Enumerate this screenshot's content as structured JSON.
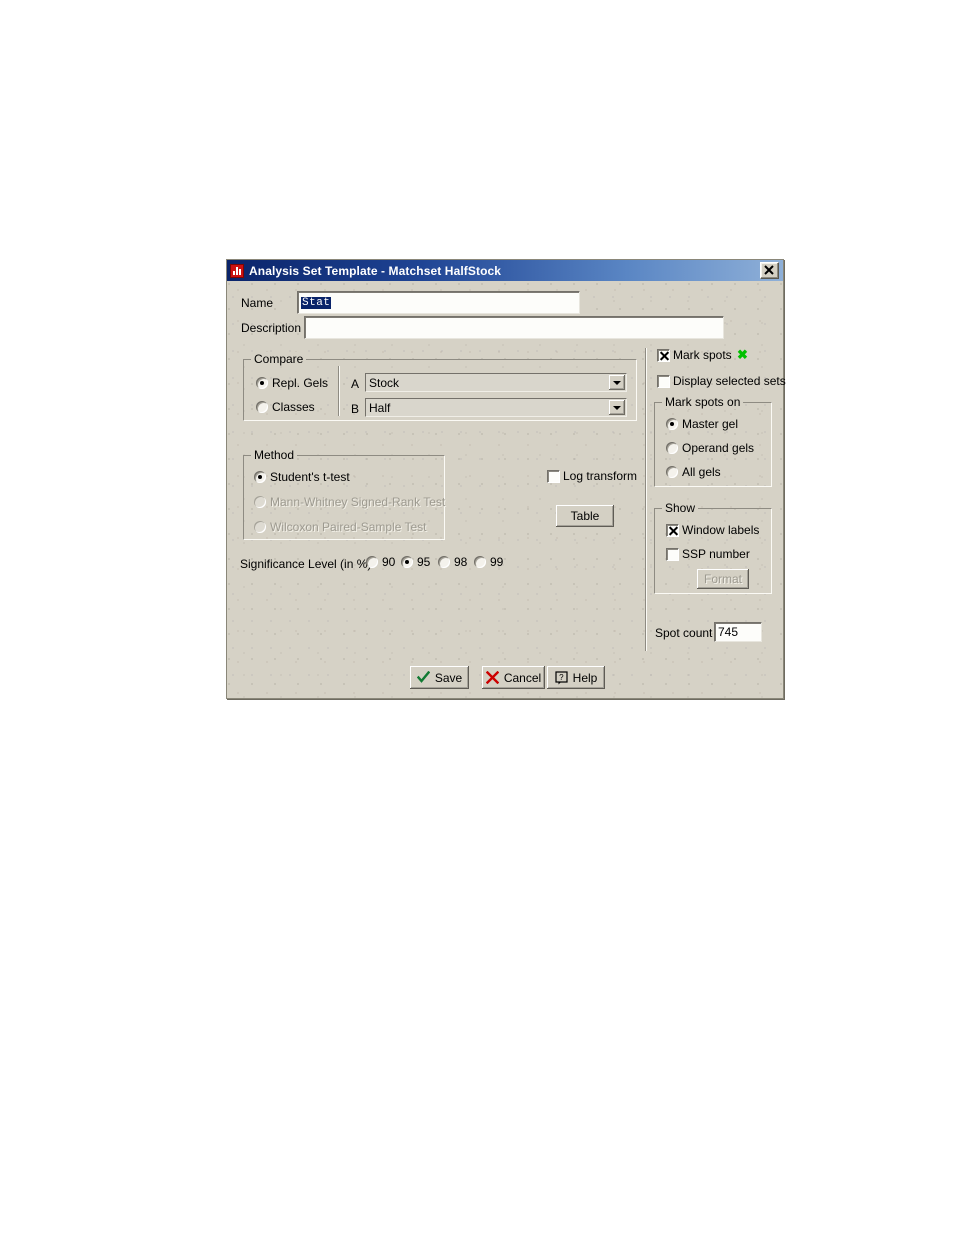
{
  "window": {
    "title": "Analysis Set Template - Matchset HalfStock",
    "app_icon": "bar-chart-icon",
    "close_label": "×",
    "titlebar_color_left": "#0a246a",
    "titlebar_color_right": "#8fb0d8",
    "background_color": "#d6d2c6"
  },
  "form": {
    "name_label": "Name",
    "name_value": "Stat",
    "name_value_selected": true,
    "description_label": "Description",
    "description_value": "",
    "description_placeholder": ""
  },
  "compare": {
    "title": "Compare",
    "mode_options": [
      {
        "label": "Repl. Gels",
        "selected": true
      },
      {
        "label": "Classes",
        "selected": false
      }
    ],
    "operands": [
      {
        "label": "A",
        "value": "Stock"
      },
      {
        "label": "B",
        "value": "Half"
      }
    ]
  },
  "method": {
    "title": "Method",
    "options": [
      {
        "label": "Student's t-test",
        "selected": true,
        "disabled": false
      },
      {
        "label": "Mann-Whitney Signed-Rank Test",
        "selected": false,
        "disabled": true
      },
      {
        "label": "Wilcoxon Paired-Sample Test",
        "selected": false,
        "disabled": true
      }
    ]
  },
  "significance": {
    "label": "Significance Level (in %)",
    "options": [
      {
        "label": "90",
        "selected": false
      },
      {
        "label": "95",
        "selected": true
      },
      {
        "label": "98",
        "selected": false
      },
      {
        "label": "99",
        "selected": false
      }
    ]
  },
  "options": {
    "log_transform_label": "Log transform",
    "log_transform_checked": false,
    "table_button_label": "Table"
  },
  "right_panel": {
    "mark_spots_label": "Mark spots",
    "mark_spots_checked": true,
    "mark_spots_swatch": "green-x-icon",
    "mark_spots_swatch_color": "#00c000",
    "display_selected_sets_label": "Display selected sets",
    "display_selected_sets_checked": false,
    "mark_spots_on": {
      "title": "Mark spots on",
      "options": [
        {
          "label": "Master gel",
          "selected": true
        },
        {
          "label": "Operand gels",
          "selected": false
        },
        {
          "label": "All gels",
          "selected": false
        }
      ]
    },
    "show": {
      "title": "Show",
      "window_labels_label": "Window labels",
      "window_labels_checked": true,
      "ssp_number_label": "SSP number",
      "ssp_number_checked": false,
      "format_button_label": "Format",
      "format_button_disabled": true
    },
    "spot_count_label": "Spot count",
    "spot_count_value": "745"
  },
  "footer": {
    "save_label": "Save",
    "save_icon": "green-check-icon",
    "cancel_label": "Cancel",
    "cancel_icon": "red-x-icon",
    "help_label": "Help",
    "help_icon": "question-balloon-icon"
  }
}
